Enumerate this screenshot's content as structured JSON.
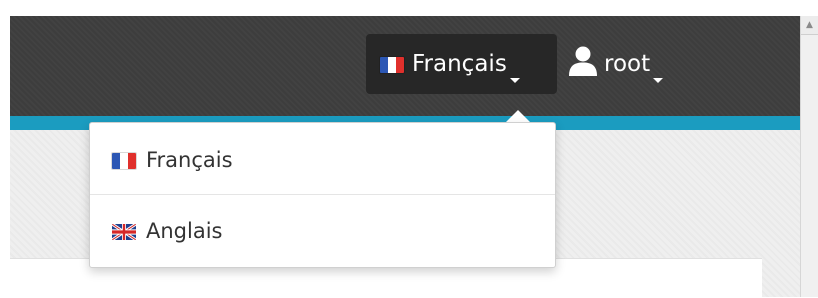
{
  "colors": {
    "navbar_bg": "#3d3d3d",
    "accent": "#1b9cc0",
    "active_toggle_bg": "#272727",
    "menu_text": "#333333"
  },
  "header": {
    "language_toggle": {
      "label": "Français",
      "flag_icon": "france-flag-icon",
      "caret_icon": "caret-down-icon"
    },
    "user_menu": {
      "label": "root",
      "icon": "user-icon",
      "caret_icon": "caret-down-icon"
    }
  },
  "language_dropdown": {
    "items": [
      {
        "label": "Français",
        "flag_icon": "france-flag-icon"
      },
      {
        "label": "Anglais",
        "flag_icon": "uk-flag-icon"
      }
    ]
  }
}
